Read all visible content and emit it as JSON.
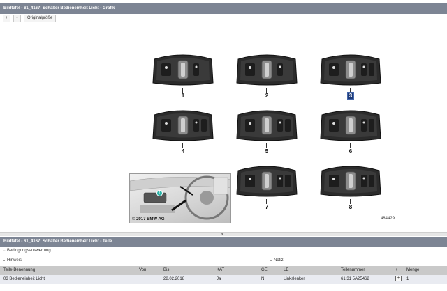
{
  "window_title": "Bildtafel - 61_4167: Schalter Bedieneinheit Licht - Grafik",
  "toolbar": {
    "zoom_in": "+",
    "zoom_out": "-",
    "original_size": "Originalgröße"
  },
  "graphic": {
    "variants": [
      "1",
      "2",
      "3",
      "4",
      "5",
      "6",
      "7",
      "8"
    ],
    "selected": "3",
    "photo_badge": "1",
    "copyright": "© 2017 BMW AG",
    "image_id": "484429"
  },
  "parts_title": "Bildtafel - 61_4167: Schalter Bedieneinheit Licht - Teile",
  "sections": {
    "conditions": "Bedingungsauswertung",
    "hint": "Hinweis",
    "note": "Notiz"
  },
  "table": {
    "headers": [
      "Teile-Benennung",
      "Von",
      "Bis",
      "KAT",
      "GE",
      "LE",
      "Teilenummer",
      "+",
      "Menge"
    ],
    "rows": [
      [
        "03 Bedieneinheit Licht",
        "",
        "28.02.2018",
        "Ja",
        "N",
        "Linkslenker",
        "61 31 5A25462",
        "",
        "1"
      ]
    ]
  },
  "colors": {
    "titlebar": "#7d8594",
    "selected": "#1e3b78",
    "row_bg": "#e9ebf1",
    "header_bg": "#c9c9c9"
  }
}
